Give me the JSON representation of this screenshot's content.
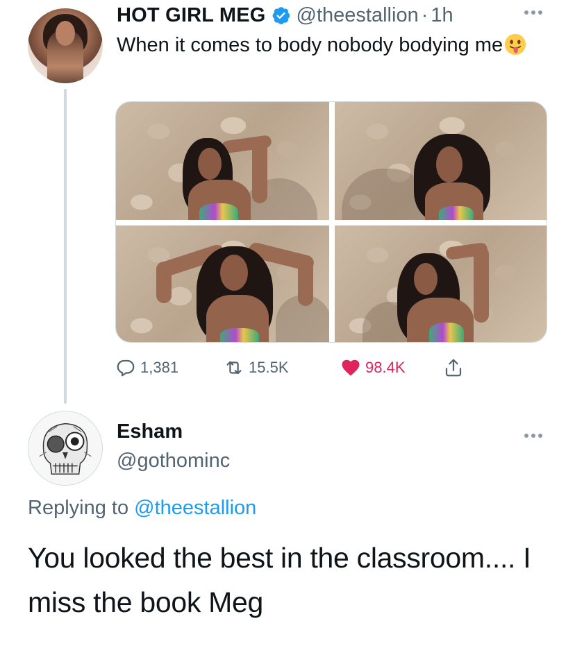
{
  "tweet": {
    "display_name": "HOT GIRL MEG",
    "verified_icon": "verified-badge-icon",
    "handle": "@theestallion",
    "separator": "·",
    "time": "1h",
    "text": "When it comes to body nobody bodying me",
    "emoji_icon": "tongue-out-face-emoji",
    "actions": {
      "reply_count": "1,381",
      "retweet_count": "15.5K",
      "like_count": "98.4K"
    }
  },
  "reply": {
    "display_name": "Esham",
    "handle": "@gothominc",
    "replying_prefix": "Replying to",
    "replying_to": "@theestallion",
    "text": "You looked the best in the classroom.... I miss the book Meg"
  },
  "colors": {
    "link_blue": "#1d9bf0",
    "like_pink": "#e0245e",
    "secondary_text": "#536471",
    "verified_blue": "#1d9bf0"
  }
}
